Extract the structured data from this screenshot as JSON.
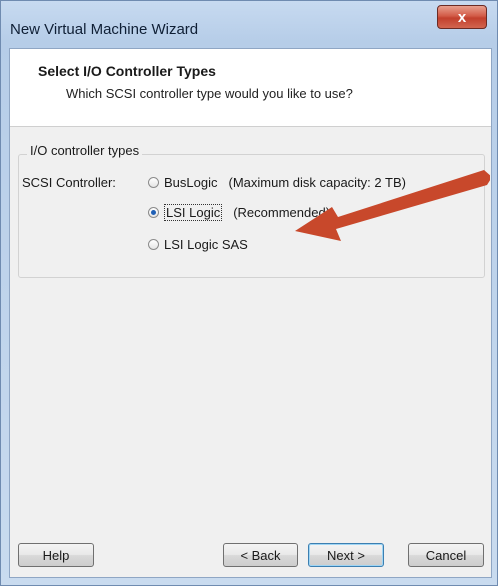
{
  "window": {
    "title": "New Virtual Machine Wizard",
    "close_label": "x"
  },
  "header": {
    "title": "Select I/O Controller Types",
    "subtitle": "Which SCSI controller type would you like to use?"
  },
  "group": {
    "label": "I/O controller types"
  },
  "scsi": {
    "label": "SCSI Controller:",
    "options": [
      {
        "label": "BusLogic",
        "note": "(Maximum disk capacity: 2 TB)",
        "checked": false
      },
      {
        "label": "LSI Logic",
        "note": "(Recommended)",
        "checked": true
      },
      {
        "label": "LSI Logic SAS",
        "note": "",
        "checked": false
      }
    ]
  },
  "annotation": {
    "color": "#c8482b",
    "icon": "red-arrow-icon"
  },
  "buttons": {
    "help": "Help",
    "back": "< Back",
    "next": "Next >",
    "cancel": "Cancel"
  }
}
